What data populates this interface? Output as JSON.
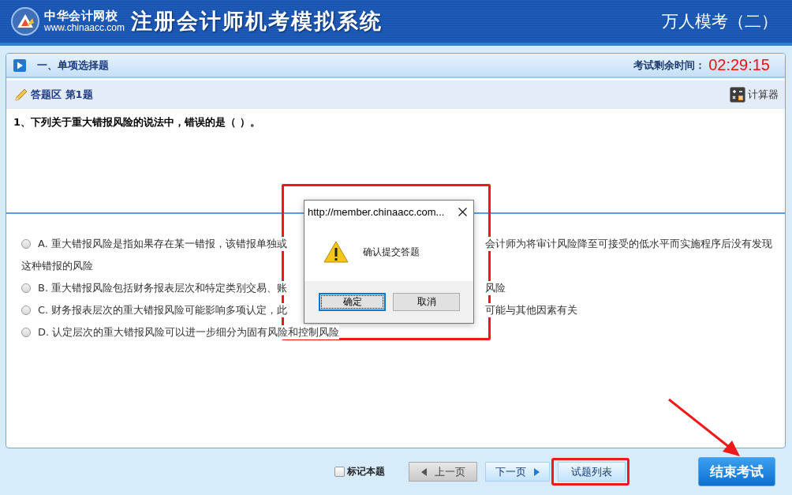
{
  "header": {
    "logo_name": "中华会计网校",
    "logo_url": "www.chinaacc.com",
    "title": "注册会计师机考模拟系统",
    "exam_name": "万人模考（二）"
  },
  "section": {
    "title": "一、单项选择题",
    "timer_label": "考试剩余时间：",
    "timer": "02:29:15"
  },
  "answer_bar": {
    "label": "答题区 第1题",
    "calculator": "计算器"
  },
  "question": "1、下列关于重大错报风险的说法中，错误的是（   ）。",
  "options": [
    {
      "letter": "A.",
      "text_before_dialog": "重大错报风险是指如果存在某一错报，该错报单独或",
      "text_after_dialog": "会计师为将审计风险降至可接受的低水平而实施程序后没有发现",
      "continuation": "这种错报的风险",
      "selected": false
    },
    {
      "letter": "B.",
      "text_before_dialog": "重大错报风险包括财务报表层次和特定类别交易、账",
      "text_after_dialog": "风险",
      "selected": false
    },
    {
      "letter": "C.",
      "text_before_dialog": "财务报表层次的重大错报风险可能影响多项认定，此",
      "text_after_dialog": "可能与其他因素有关",
      "selected": false
    },
    {
      "letter": "D.",
      "text_before_dialog": "认定层次的重大错报风险可以进一步细分为固有风险和控制风险",
      "selected": false
    }
  ],
  "dialog": {
    "title": "http://member.chinaacc.com...",
    "message": "确认提交答题",
    "buttons": [
      {
        "label": "确定",
        "focused": true
      },
      {
        "label": "取消",
        "focused": false
      }
    ]
  },
  "footer": {
    "mark": {
      "label": "标记本题",
      "checked": false
    },
    "prev": "上一页",
    "next": "下一页",
    "list": "试题列表",
    "finish": "结束考试"
  }
}
